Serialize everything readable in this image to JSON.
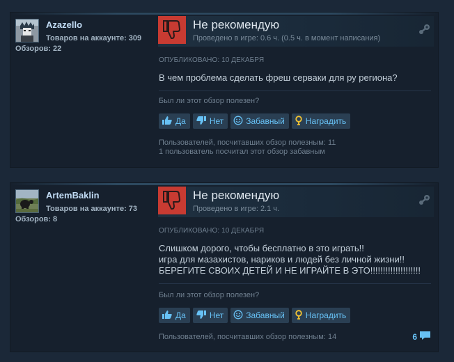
{
  "reviews": [
    {
      "author": "Azazello",
      "games_owned": "Товаров на аккаунте: 309",
      "reviews_count": "Обзоров: 22",
      "verdict": "Не рекомендую",
      "hours_label": "Проведено в игре: ",
      "hours_value": "0.6 ч. (0.5 ч. в момент написания)",
      "posted": "ОПУБЛИКОВАНО: 10 ДЕКАБРЯ",
      "text_lines": [
        "В чем проблема сделать фреш серваки для ру региона?"
      ],
      "helpful_question": "Был ли этот обзор полезен?",
      "btn_yes": "Да",
      "btn_no": "Нет",
      "btn_funny": "Забавный",
      "btn_award": "Наградить",
      "helpful_stat": "Пользователей, посчитавших обзор полезным: 11",
      "funny_stat": "1 пользователь посчитал этот обзор забавным"
    },
    {
      "author": "ArtemBaklin",
      "games_owned": "Товаров на аккаунте: 73",
      "reviews_count": "Обзоров: 8",
      "verdict": "Не рекомендую",
      "hours_label": "Проведено в игре: ",
      "hours_value": "2.1 ч.",
      "posted": "ОПУБЛИКОВАНО: 10 ДЕКАБРЯ",
      "text_lines": [
        "Слишком дорого, чтобы бесплатно в это играть!!",
        "игра для мазахистов, нариков и людей без личной жизни!!",
        "БЕРЕГИТЕ СВОИХ ДЕТЕЙ И НЕ ИГРАЙТЕ В ЭТО!!!!!!!!!!!!!!!!!!!!"
      ],
      "helpful_question": "Был ли этот обзор полезен?",
      "btn_yes": "Да",
      "btn_no": "Нет",
      "btn_funny": "Забавный",
      "btn_award": "Наградить",
      "helpful_stat": "Пользователей, посчитавших обзор полезным: 14",
      "comments_count": "6"
    }
  ],
  "colors": {
    "page_bg": "#1b2838",
    "card_bg": "#16202d",
    "thumb_down": "#c83b32",
    "link_blue": "#67c1f5",
    "username": "#c1dbf4"
  },
  "icons": {
    "verdict": "thumbs-down-icon",
    "steam": "steam-key-icon",
    "yes": "thumbs-up-icon",
    "no": "thumbs-down-icon",
    "funny": "smiley-icon",
    "award": "award-icon",
    "comments": "comment-bubble-icon"
  }
}
